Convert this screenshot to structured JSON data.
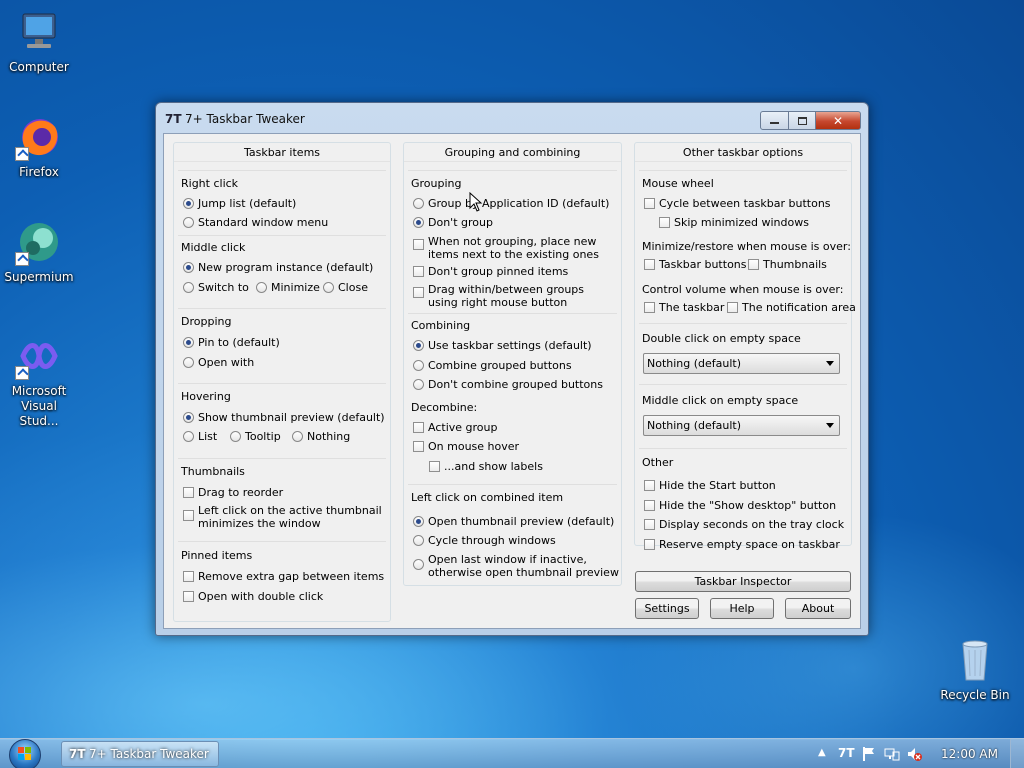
{
  "desktop": {
    "icons": [
      {
        "label": "Computer"
      },
      {
        "label": "Firefox"
      },
      {
        "label": "Supermium"
      },
      {
        "label": "Microsoft Visual Stud..."
      },
      {
        "label": "Recycle Bin"
      }
    ]
  },
  "window": {
    "title": "7+ Taskbar Tweaker",
    "icon_glyph": "7T"
  },
  "left_panel": {
    "title": "Taskbar items",
    "right_click": {
      "head": "Right click",
      "options": [
        "Jump list (default)",
        "Standard window menu"
      ],
      "selected": 0
    },
    "middle_click": {
      "head": "Middle click",
      "options": [
        "New program instance (default)",
        "Switch to",
        "Minimize",
        "Close"
      ],
      "selected": 0
    },
    "dropping": {
      "head": "Dropping",
      "options": [
        "Pin to (default)",
        "Open with"
      ],
      "selected": 0
    },
    "hovering": {
      "head": "Hovering",
      "options": [
        "Show thumbnail preview (default)",
        "List",
        "Tooltip",
        "Nothing"
      ],
      "selected": 0
    },
    "thumbnails": {
      "head": "Thumbnails",
      "options": [
        "Drag to reorder",
        "Left click on the active thumbnail",
        "minimizes the window"
      ]
    },
    "pinned_items": {
      "head": "Pinned items",
      "options": [
        "Remove extra gap between items",
        "Open with double click"
      ]
    }
  },
  "middle_panel": {
    "title": "Grouping and combining",
    "grouping": {
      "head": "Grouping",
      "options": [
        "Group by Application ID (default)",
        "Don't group"
      ],
      "selected": 1,
      "checks": [
        "When not grouping, place new",
        "items next to the existing ones",
        "Don't group pinned items",
        "Drag within/between groups",
        "using right mouse button"
      ]
    },
    "combining": {
      "head": "Combining",
      "options": [
        "Use taskbar settings (default)",
        "Combine grouped buttons",
        "Don't combine grouped buttons"
      ],
      "selected": 0
    },
    "decombine": {
      "head": "Decombine:",
      "options": [
        "Active group",
        "On mouse hover",
        "...and show labels"
      ]
    },
    "left_click_combined": {
      "head": "Left click on combined item",
      "options": [
        "Open thumbnail preview (default)",
        "Cycle through windows",
        "Open last window if inactive,",
        "otherwise open thumbnail preview"
      ],
      "selected": 0
    }
  },
  "right_panel": {
    "title": "Other taskbar options",
    "mouse_wheel": {
      "head": "Mouse wheel",
      "options": [
        "Cycle between taskbar buttons",
        "Skip minimized windows"
      ]
    },
    "minimize_restore": {
      "head": "Minimize/restore when mouse is over:",
      "options": [
        "Taskbar buttons",
        "Thumbnails"
      ]
    },
    "control_volume": {
      "head": "Control volume when mouse is over:",
      "options": [
        "The taskbar",
        "The notification area"
      ]
    },
    "double_click": {
      "head": "Double click on empty space",
      "value": "Nothing (default)"
    },
    "middle_click_empty": {
      "head": "Middle click on empty space",
      "value": "Nothing (default)"
    },
    "other": {
      "head": "Other",
      "options": [
        "Hide the Start button",
        "Hide the \"Show desktop\" button",
        "Display seconds on the tray clock",
        "Reserve empty space on taskbar"
      ]
    }
  },
  "buttons": {
    "inspector": "Taskbar Inspector",
    "settings": "Settings",
    "help": "Help",
    "about": "About"
  },
  "taskbar": {
    "task_label": "7+ Taskbar Tweaker",
    "clock": "12:00 AM"
  }
}
